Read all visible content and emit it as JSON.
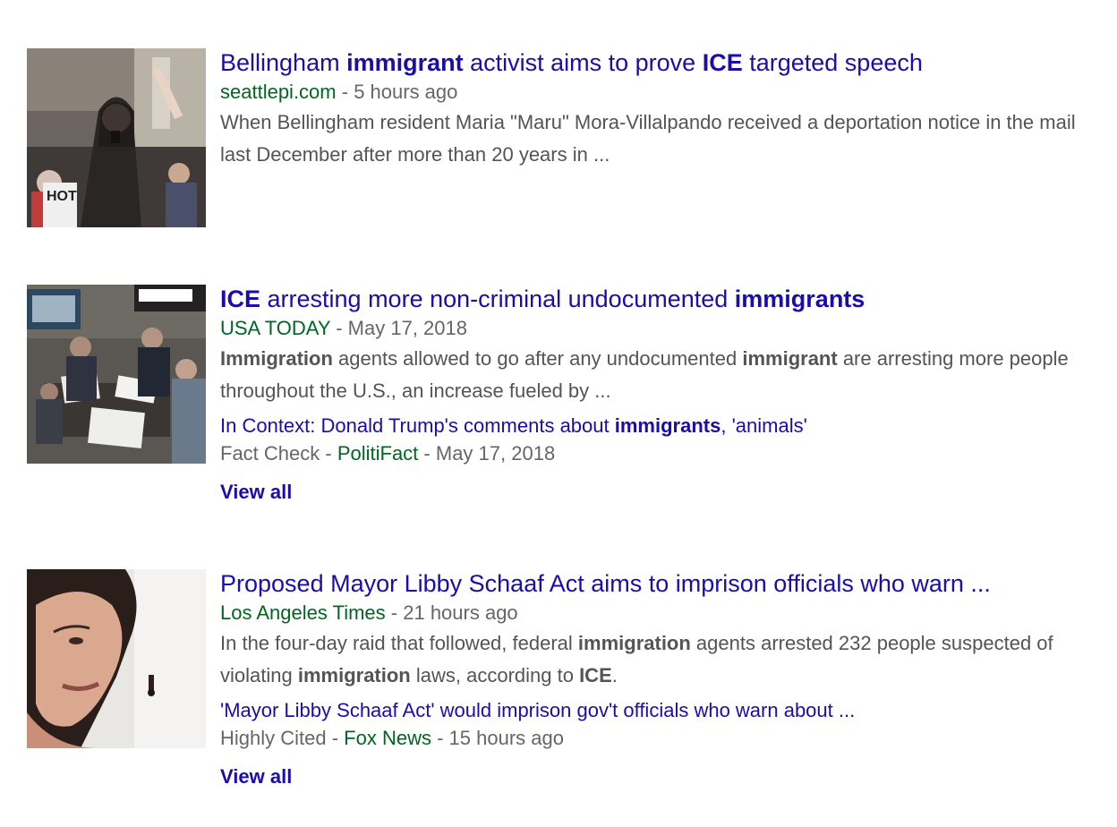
{
  "results": [
    {
      "title_parts": [
        "Bellingham ",
        "immigrant",
        " activist aims to prove ",
        "ICE",
        " targeted speech"
      ],
      "source": "seattlepi.com",
      "time": "5 hours ago",
      "snippet_parts": [
        "When Bellingham resident Maria \"Maru\" Mora-Villalpando received a deportation notice in the mail last December after more than 20 years in ..."
      ],
      "thumbnail_icon": "protester-photo"
    },
    {
      "title_parts": [
        "ICE",
        " arresting more non-criminal undocumented ",
        "immigrants"
      ],
      "source": "USA TODAY",
      "time": "May 17, 2018",
      "snippet_parts": [
        "Immigration",
        " agents allowed to go after any undocumented ",
        "immigrant",
        " are arresting more people throughout the U.S., an increase fueled by ..."
      ],
      "related_parts": [
        "In Context: Donald Trump's comments about ",
        "immigrants",
        ", 'animals'"
      ],
      "related_label": "Fact Check",
      "related_source": "PolitiFact",
      "related_time": "May 17, 2018",
      "view_all": "View all",
      "thumbnail_icon": "airport-arrivals-photo"
    },
    {
      "title_parts": [
        "Proposed Mayor Libby Schaaf Act aims to imprison officials who warn ..."
      ],
      "source": "Los Angeles Times",
      "time": "21 hours ago",
      "snippet_parts": [
        "In the four-day raid that followed, federal ",
        "immigration",
        " agents arrested 232 people suspected of violating ",
        "immigration",
        " laws, according to ",
        "ICE",
        "."
      ],
      "related_parts": [
        "'Mayor Libby Schaaf Act' would imprison gov't officials who warn about ..."
      ],
      "related_label": "Highly Cited",
      "related_source": "Fox News",
      "related_time": "15 hours ago",
      "view_all": "View all",
      "thumbnail_icon": "woman-portrait-photo"
    }
  ],
  "separator": " - ",
  "colors": {
    "link": "#1a0dab",
    "source": "#006621",
    "meta": "#666666",
    "snippet": "#545454"
  }
}
